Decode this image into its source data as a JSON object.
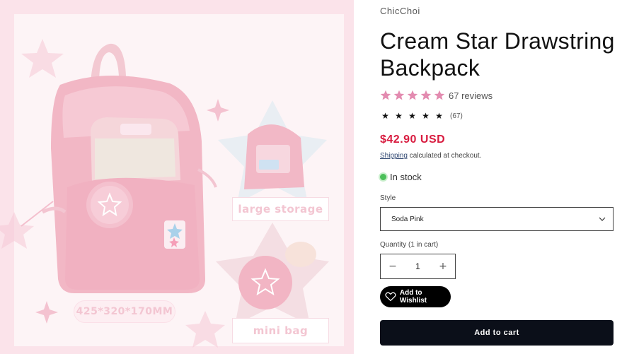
{
  "product": {
    "vendor": "ChicChoi",
    "title": "Cream Star Drawstring Backpack",
    "reviews_label": "67 reviews",
    "rating_stars": 5,
    "reviews_small": "(67)",
    "price": "$42.90 USD",
    "shipping_link": "Shipping",
    "shipping_note": "calculated at checkout.",
    "stock_status": "In stock"
  },
  "image": {
    "caption_large": "large storage",
    "caption_mini": "mini bag",
    "caption_dimensions": "425*320*170MM"
  },
  "style": {
    "label": "Style",
    "selected": "Soda Pink"
  },
  "quantity": {
    "label": "Quantity (1 in cart)",
    "value": "1",
    "minus": "−",
    "plus": "+"
  },
  "buttons": {
    "wishlist": "Add to Wishlist",
    "add_to_cart": "Add to cart"
  },
  "icons": {
    "star_rating": "star-icon",
    "chevron": "chevron-down-icon",
    "heart": "heart-icon"
  },
  "colors": {
    "price": "#d81b3f",
    "rating_star": "#e38bb0",
    "stock_dot": "#4cc05a",
    "cart_button": "#0b0f19",
    "image_background": "#fbe3ea"
  }
}
